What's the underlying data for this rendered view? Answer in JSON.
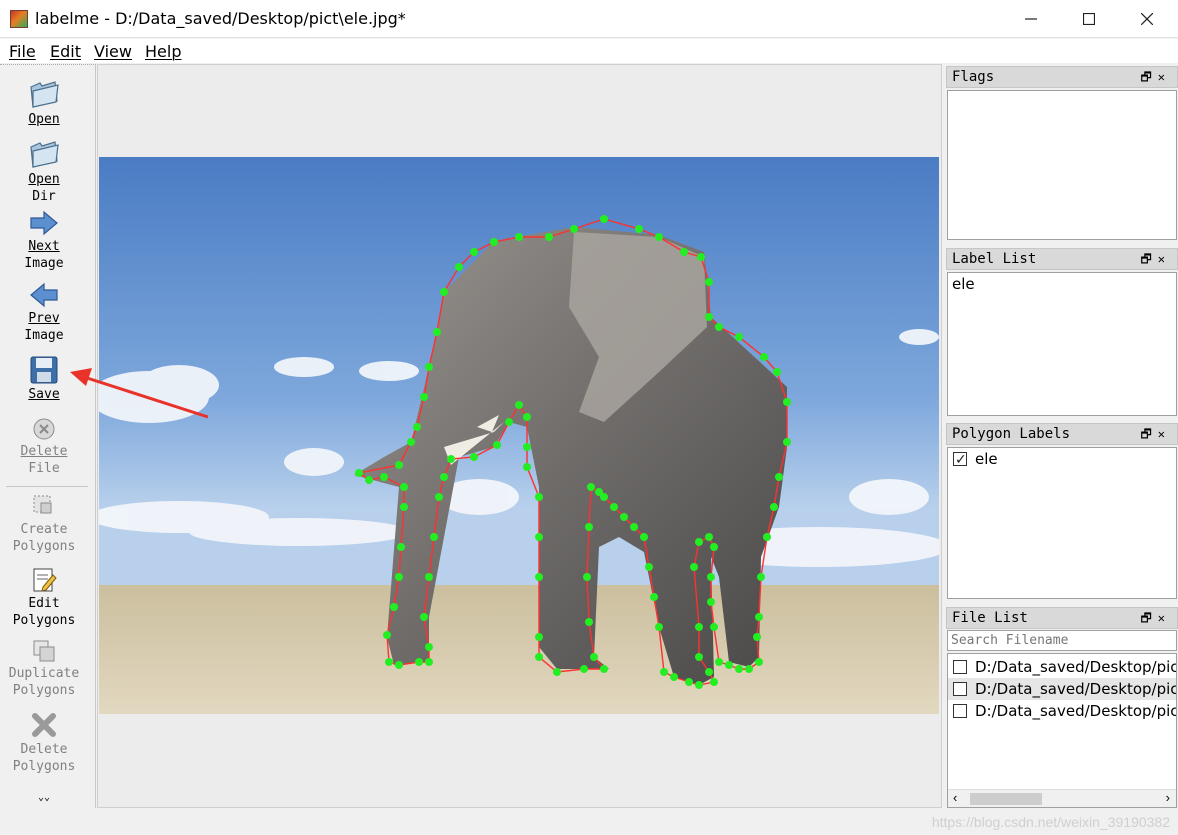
{
  "window": {
    "title": "labelme - D:/Data_saved/Desktop/pict\\ele.jpg*",
    "minimize": "—",
    "maximize": "☐",
    "close": "✕"
  },
  "menu": [
    "File",
    "Edit",
    "View",
    "Help"
  ],
  "toolbar": {
    "open": [
      "Open"
    ],
    "open_dir": [
      "Open",
      "Dir"
    ],
    "next_image": [
      "Next",
      "Image"
    ],
    "prev_image": [
      "Prev",
      "Image"
    ],
    "save": [
      "Save"
    ],
    "delete_file": [
      "Delete",
      "File"
    ],
    "create_polygons": [
      "Create",
      "Polygons"
    ],
    "edit_polygons": [
      "Edit",
      "Polygons"
    ],
    "duplicate_polygons": [
      "Duplicate",
      "Polygons"
    ],
    "delete_polygons": [
      "Delete",
      "Polygons"
    ],
    "more": "⌄⌄"
  },
  "panels": {
    "flags": {
      "title": "Flags"
    },
    "label_list": {
      "title": "Label List",
      "items": [
        "ele"
      ]
    },
    "polygon_labels": {
      "title": "Polygon Labels",
      "items": [
        {
          "label": "ele",
          "checked": true
        }
      ]
    },
    "file_list": {
      "title": "File List",
      "search_placeholder": "Search Filename",
      "files": [
        {
          "path": "D:/Data_saved/Desktop/pict",
          "checked": false,
          "selected": false
        },
        {
          "path": "D:/Data_saved/Desktop/pict",
          "checked": false,
          "selected": true
        },
        {
          "path": "D:/Data_saved/Desktop/pict",
          "checked": false,
          "selected": false
        }
      ]
    },
    "float_icon": "🗗",
    "close_icon": "✕"
  },
  "annotation": {
    "polygon_label": "ele",
    "line_color": "#ff3030",
    "point_color": "#22ee22"
  },
  "statusbar": {
    "watermark": "https://blog.csdn.net/weixin_39190382"
  },
  "colors": {
    "sky_top": "#4f7fc4",
    "sky_bottom": "#9cc0e6",
    "ground": "#d6c9a8",
    "arrow": "#e8322a"
  }
}
